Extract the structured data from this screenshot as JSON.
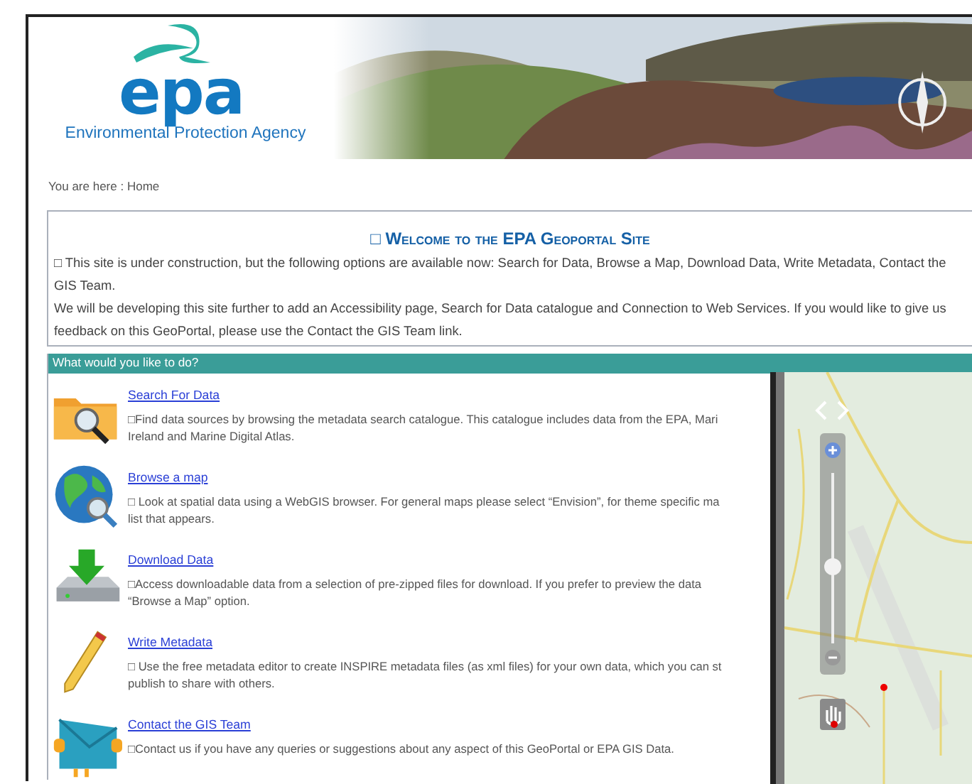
{
  "header": {
    "logo_text": "epa",
    "agency_name": "Environmental Protection Agency"
  },
  "breadcrumb": "You are here : Home",
  "welcome": {
    "title": "□ Welcome to the EPA Geoportal Site",
    "paragraphs": [
      "□ This site is under construction, but the following options are available now: Search for Data, Browse a Map, Download Data, Write Metadata, Contact the GIS Team.",
      "We will be developing this site further to add an Accessibility page, Search for Data catalogue and Connection to Web Services. If you would like to give us feedback on this GeoPortal, please use the Contact the GIS Team link."
    ]
  },
  "options_bar": "What would you like to do?",
  "options": [
    {
      "kind": "search",
      "link": "Search For Data",
      "lines": [
        "□Find data sources by browsing the metadata search catalogue. This catalogue includes data from the EPA, Mari",
        "Ireland and Marine Digital Atlas."
      ]
    },
    {
      "kind": "globe",
      "link": "Browse a map",
      "lines": [
        "□ Look at spatial data using a WebGIS browser. For general maps please select “Envision”, for theme specific ma",
        "list that appears."
      ]
    },
    {
      "kind": "download",
      "link": "Download Data",
      "lines": [
        "□Access downloadable data from a selection of pre-zipped files for download. If you prefer to preview the data",
        "“Browse a Map” option."
      ]
    },
    {
      "kind": "pencil",
      "link": "Write Metadata",
      "lines": [
        "□ Use the free metadata editor to create INSPIRE metadata files (as xml files) for your own data, which you can st",
        "publish to share with others."
      ]
    },
    {
      "kind": "mail",
      "link": "Contact the GIS Team",
      "lines": [
        "□Contact us if you have any queries or suggestions about any aspect of this GeoPortal or EPA GIS Data."
      ]
    }
  ],
  "map": {
    "kind": "picture",
    "zoom": {
      "level": 0.45
    }
  }
}
